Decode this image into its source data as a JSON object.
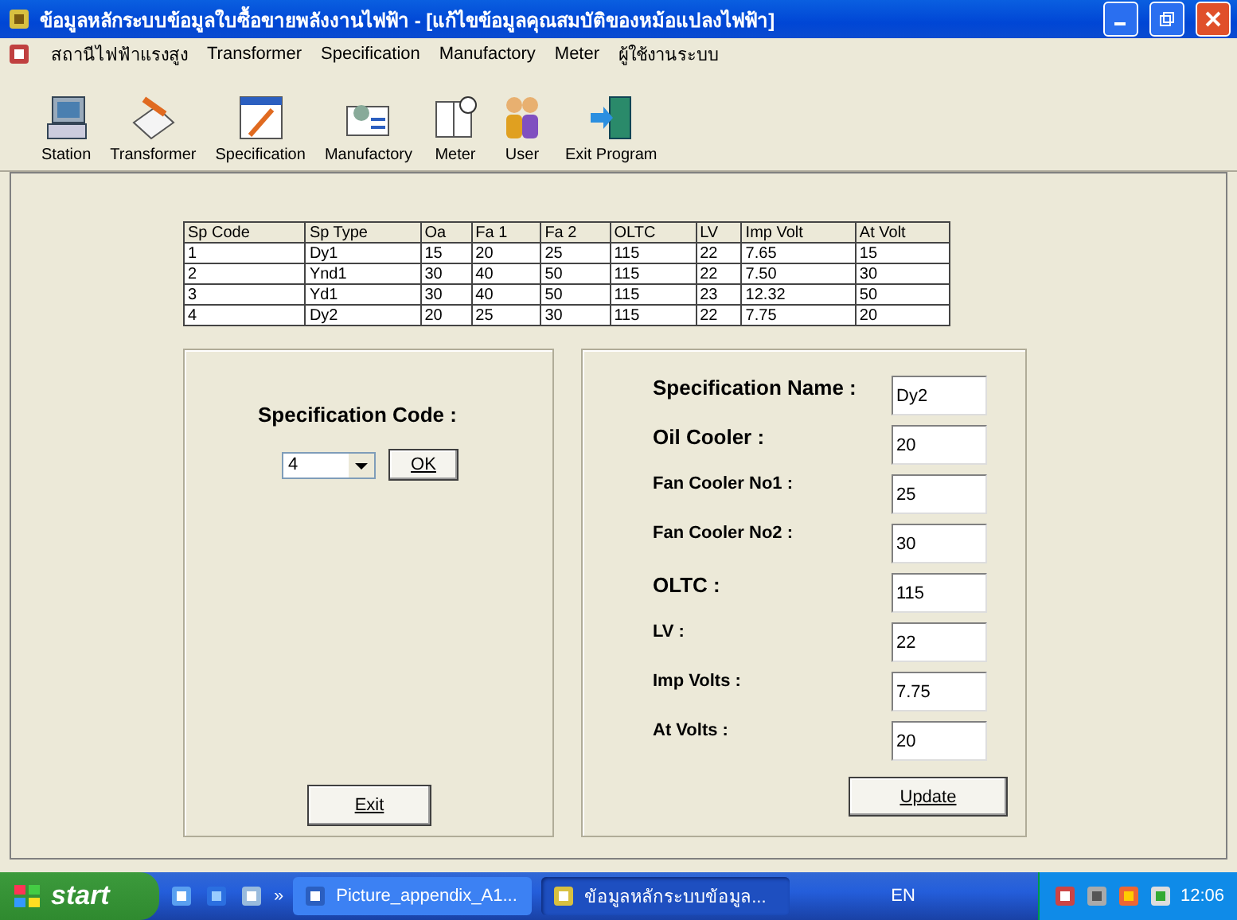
{
  "window": {
    "title": "ข้อมูลหลักระบบข้อมูลใบซื้อขายพลังงานไฟฟ้า - [แก้ไขข้อมูลคุณสมบัติของหม้อแปลงไฟฟ้า]"
  },
  "menu": [
    "สถานีไฟฟ้าแรงสูง",
    "Transformer",
    "Specification",
    "Manufactory",
    "Meter",
    "ผู้ใช้งานระบบ"
  ],
  "toolbar": [
    {
      "label": "Station",
      "kind": "station"
    },
    {
      "label": "Transformer",
      "kind": "transformer"
    },
    {
      "label": "Specification",
      "kind": "specification"
    },
    {
      "label": "Manufactory",
      "kind": "manufactory"
    },
    {
      "label": "Meter",
      "kind": "meter"
    },
    {
      "label": "User",
      "kind": "user"
    },
    {
      "label": "Exit Program",
      "kind": "exit"
    }
  ],
  "table": {
    "columns": [
      "Sp Code",
      "Sp Type",
      "Oa",
      "Fa 1",
      "Fa 2",
      "OLTC",
      "LV",
      "Imp Volt",
      "At Volt"
    ],
    "rows": [
      [
        "1",
        "Dy1",
        "15",
        "20",
        "25",
        "115",
        "22",
        "7.65",
        "15"
      ],
      [
        "2",
        "Ynd1",
        "30",
        "40",
        "50",
        "115",
        "22",
        "7.50",
        "30"
      ],
      [
        "3",
        "Yd1",
        "30",
        "40",
        "50",
        "115",
        "23",
        "12.32",
        "50"
      ],
      [
        "4",
        "Dy2",
        "20",
        "25",
        "30",
        "115",
        "22",
        "7.75",
        "20"
      ]
    ]
  },
  "code_panel": {
    "label": "Specification Code :",
    "value": "4",
    "ok": "OK",
    "exit": "Exit"
  },
  "detail_panel": {
    "fields": [
      {
        "label": "Specification Name :",
        "value": "Dy2"
      },
      {
        "label": "Oil Cooler :",
        "value": "20"
      },
      {
        "label": "Fan Cooler No1 :",
        "value": "25"
      },
      {
        "label": "Fan Cooler No2 :",
        "value": "30"
      },
      {
        "label": "OLTC :",
        "value": "115"
      },
      {
        "label": "LV :",
        "value": "22"
      },
      {
        "label": "Imp Volts :",
        "value": "7.75"
      },
      {
        "label": "At Volts :",
        "value": "20"
      }
    ],
    "update": "Update"
  },
  "taskbar": {
    "start": "start",
    "quick_more": "»",
    "tasks": [
      {
        "label": "Picture_appendix_A1...",
        "selected": false
      },
      {
        "label": "ข้อมูลหลักระบบข้อมูล...",
        "selected": true
      }
    ],
    "language": "EN",
    "clock": "12:06"
  }
}
